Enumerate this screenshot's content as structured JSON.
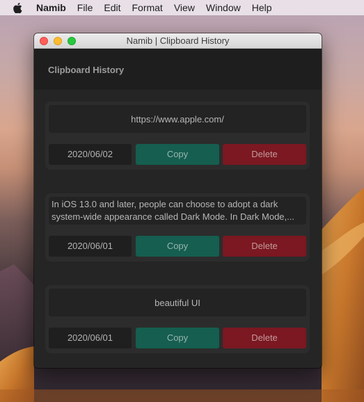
{
  "menubar": {
    "apple_icon": "apple-icon",
    "app_name": "Namib",
    "items": [
      "File",
      "Edit",
      "Format",
      "View",
      "Window",
      "Help"
    ]
  },
  "window": {
    "title": "Namib | Clipboard History",
    "header_title": "Clipboard History"
  },
  "entries": [
    {
      "text": "https://www.apple.com/",
      "date": "2020/06/02",
      "copy_label": "Copy",
      "delete_label": "Delete"
    },
    {
      "text": "In iOS 13.0 and later, people can choose to adopt a dark system-wide appearance called Dark Mode. In Dark Mode,...",
      "date": "2020/06/01",
      "copy_label": "Copy",
      "delete_label": "Delete"
    },
    {
      "text": "beautiful UI",
      "date": "2020/06/01",
      "copy_label": "Copy",
      "delete_label": "Delete"
    }
  ],
  "colors": {
    "copy_button": "#155e50",
    "delete_button": "#7b1821",
    "window_bg": "#252525",
    "card_bg": "#2c2c2c"
  }
}
